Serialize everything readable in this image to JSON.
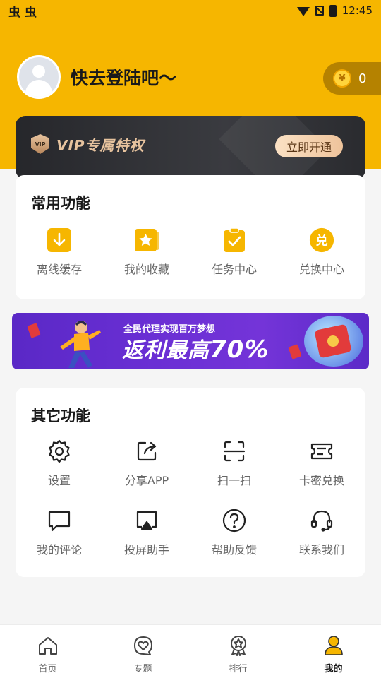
{
  "status_bar": {
    "left_icons": [
      "虫",
      "虫"
    ],
    "time": "12:45"
  },
  "profile": {
    "login_prompt": "快去登陆吧〜",
    "coin_symbol": "¥",
    "coin_count": "0"
  },
  "vip": {
    "badge": "VIP",
    "title": "VIP专属特权",
    "button": "立即开通"
  },
  "common": {
    "title": "常用功能",
    "items": [
      {
        "label": "离线缓存",
        "icon": "download-icon"
      },
      {
        "label": "我的收藏",
        "icon": "star-icon"
      },
      {
        "label": "任务中心",
        "icon": "clipboard-check-icon"
      },
      {
        "label": "兑换中心",
        "icon": "exchange-icon",
        "glyph": "兑"
      }
    ]
  },
  "banner": {
    "subtitle": "全民代理实现百万梦想",
    "headline": "返利最高",
    "percent": "70%"
  },
  "other": {
    "title": "其它功能",
    "items": [
      {
        "label": "设置",
        "icon": "gear-icon"
      },
      {
        "label": "分享APP",
        "icon": "share-icon"
      },
      {
        "label": "扫一扫",
        "icon": "scan-icon"
      },
      {
        "label": "卡密兑换",
        "icon": "ticket-icon"
      },
      {
        "label": "我的评论",
        "icon": "comment-icon"
      },
      {
        "label": "投屏助手",
        "icon": "cast-icon"
      },
      {
        "label": "帮助反馈",
        "icon": "help-icon"
      },
      {
        "label": "联系我们",
        "icon": "headset-icon"
      }
    ]
  },
  "tabbar": {
    "items": [
      {
        "label": "首页",
        "icon": "home-icon"
      },
      {
        "label": "专题",
        "icon": "heart-chat-icon"
      },
      {
        "label": "排行",
        "icon": "medal-icon"
      },
      {
        "label": "我的",
        "icon": "user-icon"
      }
    ],
    "active_index": 3
  },
  "colors": {
    "brand_yellow": "#f6b600",
    "vip_gold": "#e7c39e",
    "banner_purple": "#6a2fd4"
  }
}
